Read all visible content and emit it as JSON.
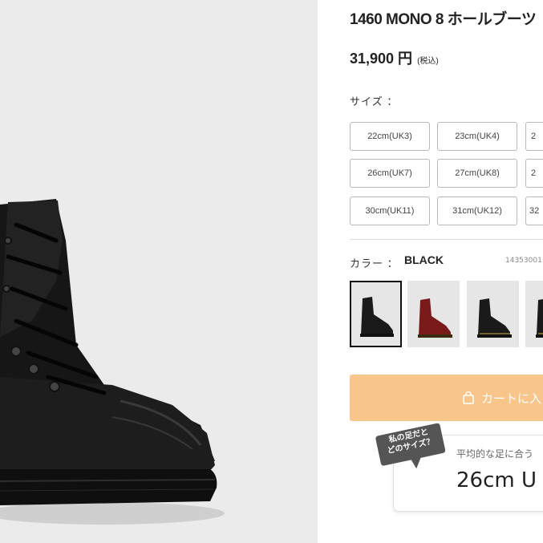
{
  "product": {
    "title": "1460 MONO 8 ホールブーツ",
    "price": "31,900 円",
    "tax_note": "(税込)"
  },
  "size": {
    "label": "サイズ ：",
    "options": [
      "22cm(UK3)",
      "23cm(UK4)",
      "2",
      "26cm(UK7)",
      "27cm(UK8)",
      "2",
      "30cm(UK11)",
      "31cm(UK12)",
      "32"
    ]
  },
  "color": {
    "label": "カラー ：",
    "selected": "BLACK",
    "sku": "14353001",
    "swatches": [
      {
        "name": "black-mono",
        "boot_color": "#1a1a1a",
        "sole_color": "#1a1a1a"
      },
      {
        "name": "cherry-red",
        "boot_color": "#7a1a1a",
        "sole_color": "#3a2a10"
      },
      {
        "name": "black-smooth",
        "boot_color": "#1a1a1a",
        "sole_color": "#1a1a1a"
      },
      {
        "name": "black-yellow-stitch",
        "boot_color": "#1a1a1a",
        "sole_color": "#1a1a1a"
      }
    ]
  },
  "cart": {
    "label": "カートに入"
  },
  "fit": {
    "bubble": [
      "私の足だと",
      "どのサイズ？"
    ],
    "caption": "平均的な足に合う",
    "value": "26cm U"
  },
  "colors": {
    "cart_bg": "#f8c68a",
    "bubble_bg": "#555555",
    "left_bg": "#ebebeb"
  }
}
